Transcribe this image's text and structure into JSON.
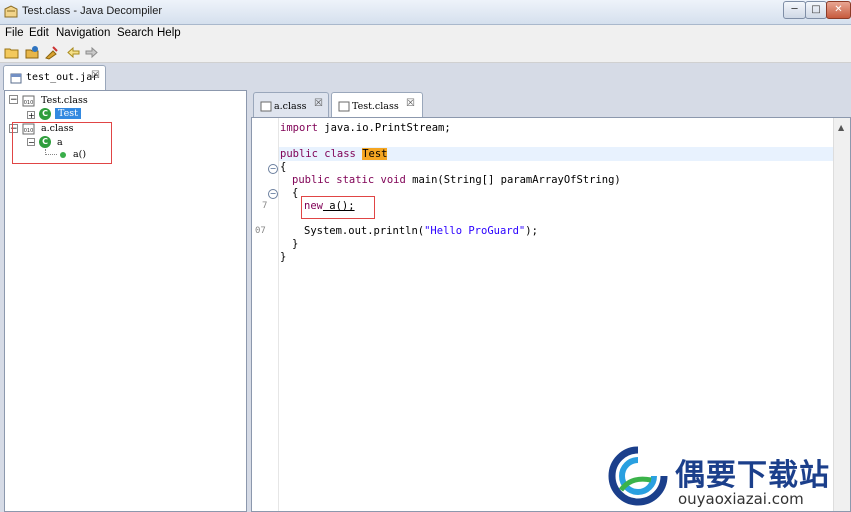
{
  "window": {
    "title": "Test.class - Java Decompiler",
    "min": "─",
    "max": "□",
    "close": "✕"
  },
  "menu": [
    "File",
    "Edit",
    "Navigation",
    "Search",
    "Help"
  ],
  "jar_tab": {
    "label": "test_out.jar",
    "close": "☒"
  },
  "tree": {
    "root1": "Test.class",
    "root1_child": "Test",
    "root2": "a.class",
    "root2_child": "a",
    "root2_leaf": "a()"
  },
  "editor_tabs": [
    {
      "label": "a.class",
      "close": "☒"
    },
    {
      "label": "Test.class",
      "close": "☒"
    }
  ],
  "code": {
    "line1": {
      "kw": "import",
      "rest": " java.io.PrintStream;"
    },
    "line2": {
      "kw": "public class",
      "name": "Test"
    },
    "line3": "{",
    "line4": {
      "kw": "public static void",
      "rest": " main(String[] paramArrayOfString)"
    },
    "line5": "{",
    "line6": {
      "kw": "new",
      "rest": " a();"
    },
    "line7": {
      "pre": "System.out.println(",
      "str": "\"Hello ProGuard\"",
      "post": ");"
    },
    "line8": "}",
    "line9": "}",
    "lnum_a": "7",
    "lnum_b": "07"
  },
  "watermark": {
    "cn": "偶要下载站",
    "url": "ouyaoxiazai.com"
  },
  "colors": {
    "keyword": "#7f0055",
    "string": "#2a00ff",
    "highlight": "#f5a623",
    "annotation": "#e04545"
  }
}
